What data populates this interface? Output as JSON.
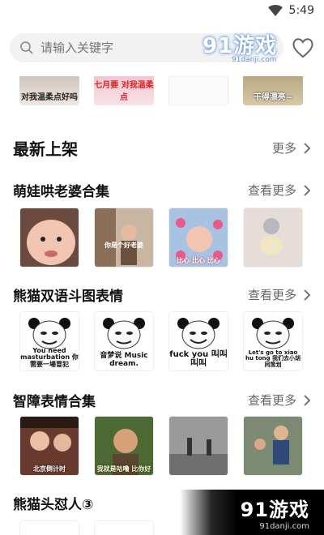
{
  "status": {
    "time": "5:49"
  },
  "search": {
    "placeholder": "请输入关键字"
  },
  "watermark": {
    "logo": "91游戏",
    "site": "91danji.com"
  },
  "strip": [
    {
      "caption": "对我温柔点好吗",
      "color": "#e8e0d8"
    },
    {
      "caption": "七月要 对我温柔点",
      "color": "#f5d6dc"
    },
    {
      "caption": "",
      "color": "#f4f4f4"
    },
    {
      "caption": "干得漂亮~",
      "color": "#cdbf9e"
    }
  ],
  "new_section": {
    "title": "最新上架",
    "more": "更多"
  },
  "groups": [
    {
      "title": "萌娃哄老婆合集",
      "more": "查看更多",
      "items": [
        {
          "caption": "",
          "color": "#e9b7a6"
        },
        {
          "caption": "你是个好老婆",
          "color": "#b49a82"
        },
        {
          "caption": "比心 比心 比心",
          "color": "#9fb7d8"
        },
        {
          "caption": "",
          "color": "#ddd3cf"
        }
      ]
    },
    {
      "title": "熊猫双语斗图表情",
      "more": "查看更多",
      "items": [
        {
          "caption": "You need masturbation 你需要一場冒犯",
          "color": "#ffffff"
        },
        {
          "caption": "音梦说 Music dream.",
          "color": "#ffffff"
        },
        {
          "caption": "fuck you 叫叫 叫叫",
          "color": "#ffffff"
        },
        {
          "caption": "Let's go to xiao hu tong 我们去小胡同策划",
          "color": "#ffffff"
        }
      ]
    },
    {
      "title": "智障表情合集",
      "more": "查看更多",
      "items": [
        {
          "caption": "北京倒计时",
          "color": "#7a4a3a"
        },
        {
          "caption": "我就是咕噜 比你好",
          "color": "#3f5a2a"
        },
        {
          "caption": "",
          "color": "#8a8a8a"
        },
        {
          "caption": "",
          "color": "#6a6a6a"
        }
      ]
    },
    {
      "title": "熊猫头怼人③",
      "more": "",
      "items": []
    }
  ]
}
